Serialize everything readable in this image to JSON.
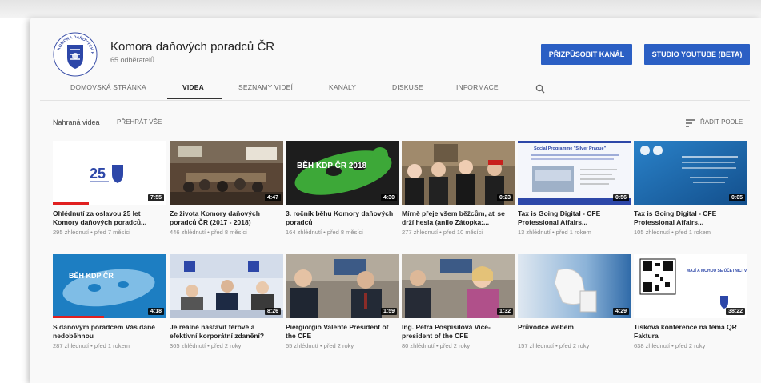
{
  "channel": {
    "title": "Komora daňových poradců ČR",
    "subscribers": "65 odběratelů",
    "logo_text": "KOMORA DAŇOVÝCH PORADCŮ"
  },
  "buttons": {
    "customize": "PŘIZPŮSOBIT KANÁL",
    "studio": "STUDIO YOUTUBE (BETA)"
  },
  "tabs": [
    {
      "label": "DOMOVSKÁ STRÁNKA",
      "active": false
    },
    {
      "label": "VIDEA",
      "active": true
    },
    {
      "label": "SEZNAMY VIDEÍ",
      "active": false
    },
    {
      "label": "KANÁLY",
      "active": false
    },
    {
      "label": "DISKUSE",
      "active": false
    },
    {
      "label": "INFORMACE",
      "active": false
    }
  ],
  "section": {
    "label": "Nahraná videa",
    "play_all": "PŘEHRÁT VŠE",
    "sort_label": "ŘADIT PODLE"
  },
  "videos": [
    {
      "title": "Ohlédnutí za oslavou 25 let Komory daňových poradců...",
      "meta": "295 zhlédnutí • před 7 měsíci",
      "duration": "7:55",
      "progress": 0.32,
      "thumb_text": "25"
    },
    {
      "title": "Ze života Komory daňových poradců ČR (2017 - 2018)",
      "meta": "446 zhlédnutí • před 8 měsíci",
      "duration": "4:47",
      "progress": 0.0,
      "thumb_text": ""
    },
    {
      "title": "3. ročník běhu Komory daňových poradců",
      "meta": "164 zhlédnutí • před 8 měsíci",
      "duration": "4:30",
      "progress": 0.0,
      "thumb_text": "BĚH KDP ČR 2018"
    },
    {
      "title": "Mírně přeje všem běžcům, ať se drží hesla (anilo Zátopka:...",
      "meta": "277 zhlédnutí • před 10 měsíci",
      "duration": "0:23",
      "progress": 0.0,
      "thumb_text": ""
    },
    {
      "title": "Tax is Going Digital - CFE Professional Affairs...",
      "meta": "13 zhlédnutí • před 1 rokem",
      "duration": "0:56",
      "progress": 0.0,
      "thumb_text": "Social Programme \"Silver Prague\""
    },
    {
      "title": "Tax is Going Digital - CFE Professional Affairs...",
      "meta": "105 zhlédnutí • před 1 rokem",
      "duration": "0:05",
      "progress": 0.0,
      "thumb_text": ""
    },
    {
      "title": "S daňovým poradcem Vás daně nedoběhnou",
      "meta": "287 zhlédnutí • před 1 rokem",
      "duration": "4:18",
      "progress": 0.45,
      "thumb_text": "BĚH KDP ČR"
    },
    {
      "title": "Je reálné nastavit férové a efektivní korporátní zdanění?",
      "meta": "365 zhlédnutí • před 2 roky",
      "duration": "8:26",
      "progress": 0.0,
      "thumb_text": ""
    },
    {
      "title": "Piergiorgio Valente President of the CFE",
      "meta": "55 zhlédnutí • před 2 roky",
      "duration": "1:59",
      "progress": 0.0,
      "thumb_text": ""
    },
    {
      "title": "Ing. Petra Pospíšilová Vice-president of the CFE",
      "meta": "80 zhlédnutí • před 2 roky",
      "duration": "1:32",
      "progress": 0.0,
      "thumb_text": ""
    },
    {
      "title": "Průvodce webem",
      "meta": "157 zhlédnutí • před 2 roky",
      "duration": "4:29",
      "progress": 0.0,
      "thumb_text": ""
    },
    {
      "title": "Tisková konference na téma QR Faktura",
      "meta": "638 zhlédnutí • před 2 roky",
      "duration": "38:22",
      "progress": 0.0,
      "thumb_text": "MAJÍ A MOHOU SE ÚČETNICTVÍ ZA ROK 2017?"
    }
  ],
  "colors": {
    "accent": "#2b5fc4",
    "progress": "#e02020"
  }
}
